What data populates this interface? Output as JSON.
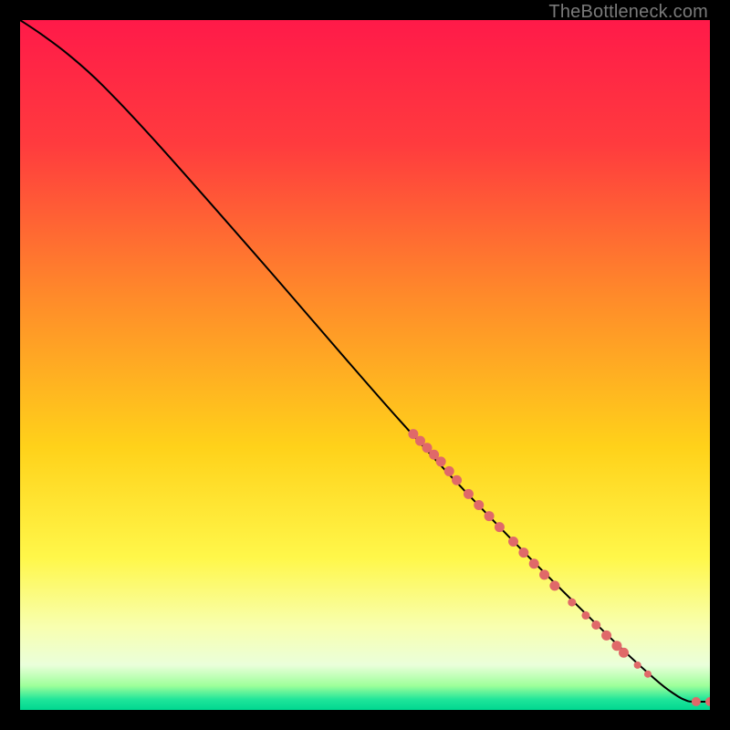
{
  "watermark": "TheBottleneck.com",
  "chart_data": {
    "type": "line",
    "title": "",
    "xlabel": "",
    "ylabel": "",
    "xlim": [
      0,
      100
    ],
    "ylim": [
      0,
      100
    ],
    "background_gradient": {
      "stops": [
        {
          "offset": 0,
          "color": "#ff1a49"
        },
        {
          "offset": 0.18,
          "color": "#ff3b3e"
        },
        {
          "offset": 0.4,
          "color": "#ff8a2a"
        },
        {
          "offset": 0.62,
          "color": "#ffd21a"
        },
        {
          "offset": 0.78,
          "color": "#fff74a"
        },
        {
          "offset": 0.88,
          "color": "#f8ffb0"
        },
        {
          "offset": 0.935,
          "color": "#eaffda"
        },
        {
          "offset": 0.965,
          "color": "#9DFF9A"
        },
        {
          "offset": 0.985,
          "color": "#1FE59A"
        },
        {
          "offset": 1.0,
          "color": "#00d790"
        }
      ]
    },
    "series": [
      {
        "name": "curve",
        "kind": "path",
        "stroke": "#000000",
        "points": [
          {
            "x": 0,
            "y": 100
          },
          {
            "x": 3,
            "y": 98
          },
          {
            "x": 7,
            "y": 95
          },
          {
            "x": 12,
            "y": 90.5
          },
          {
            "x": 20,
            "y": 82
          },
          {
            "x": 35,
            "y": 65
          },
          {
            "x": 55,
            "y": 42
          },
          {
            "x": 70,
            "y": 26
          },
          {
            "x": 85,
            "y": 11
          },
          {
            "x": 92,
            "y": 4.5
          },
          {
            "x": 95,
            "y": 2.2
          },
          {
            "x": 96.5,
            "y": 1.4
          },
          {
            "x": 97.5,
            "y": 1.2
          },
          {
            "x": 100,
            "y": 1.2
          }
        ]
      },
      {
        "name": "markers",
        "kind": "scatter",
        "fill": "#e06969",
        "points": [
          {
            "x": 57,
            "y": 40,
            "r": 5.5
          },
          {
            "x": 58,
            "y": 39,
            "r": 5.5
          },
          {
            "x": 59,
            "y": 38,
            "r": 5.5
          },
          {
            "x": 60,
            "y": 37,
            "r": 5.5
          },
          {
            "x": 61,
            "y": 36,
            "r": 5.5
          },
          {
            "x": 62.2,
            "y": 34.6,
            "r": 5.5
          },
          {
            "x": 63.3,
            "y": 33.3,
            "r": 5.5
          },
          {
            "x": 65,
            "y": 31.3,
            "r": 5.5
          },
          {
            "x": 66.5,
            "y": 29.7,
            "r": 5.5
          },
          {
            "x": 68,
            "y": 28.1,
            "r": 5.5
          },
          {
            "x": 69.5,
            "y": 26.5,
            "r": 5.5
          },
          {
            "x": 71.5,
            "y": 24.4,
            "r": 5.5
          },
          {
            "x": 73,
            "y": 22.8,
            "r": 5.5
          },
          {
            "x": 74.5,
            "y": 21.2,
            "r": 5.5
          },
          {
            "x": 76,
            "y": 19.6,
            "r": 5.5
          },
          {
            "x": 77.5,
            "y": 18,
            "r": 5.5
          },
          {
            "x": 80,
            "y": 15.6,
            "r": 4.5
          },
          {
            "x": 82,
            "y": 13.7,
            "r": 4.5
          },
          {
            "x": 83.5,
            "y": 12.3,
            "r": 5.0
          },
          {
            "x": 85,
            "y": 10.8,
            "r": 5.5
          },
          {
            "x": 86.5,
            "y": 9.3,
            "r": 5.5
          },
          {
            "x": 87.5,
            "y": 8.3,
            "r": 5.5
          },
          {
            "x": 89.5,
            "y": 6.5,
            "r": 4.0
          },
          {
            "x": 91,
            "y": 5.2,
            "r": 4.0
          },
          {
            "x": 98,
            "y": 1.2,
            "r": 5.0
          },
          {
            "x": 100,
            "y": 1.2,
            "r": 5.0
          }
        ]
      }
    ]
  }
}
